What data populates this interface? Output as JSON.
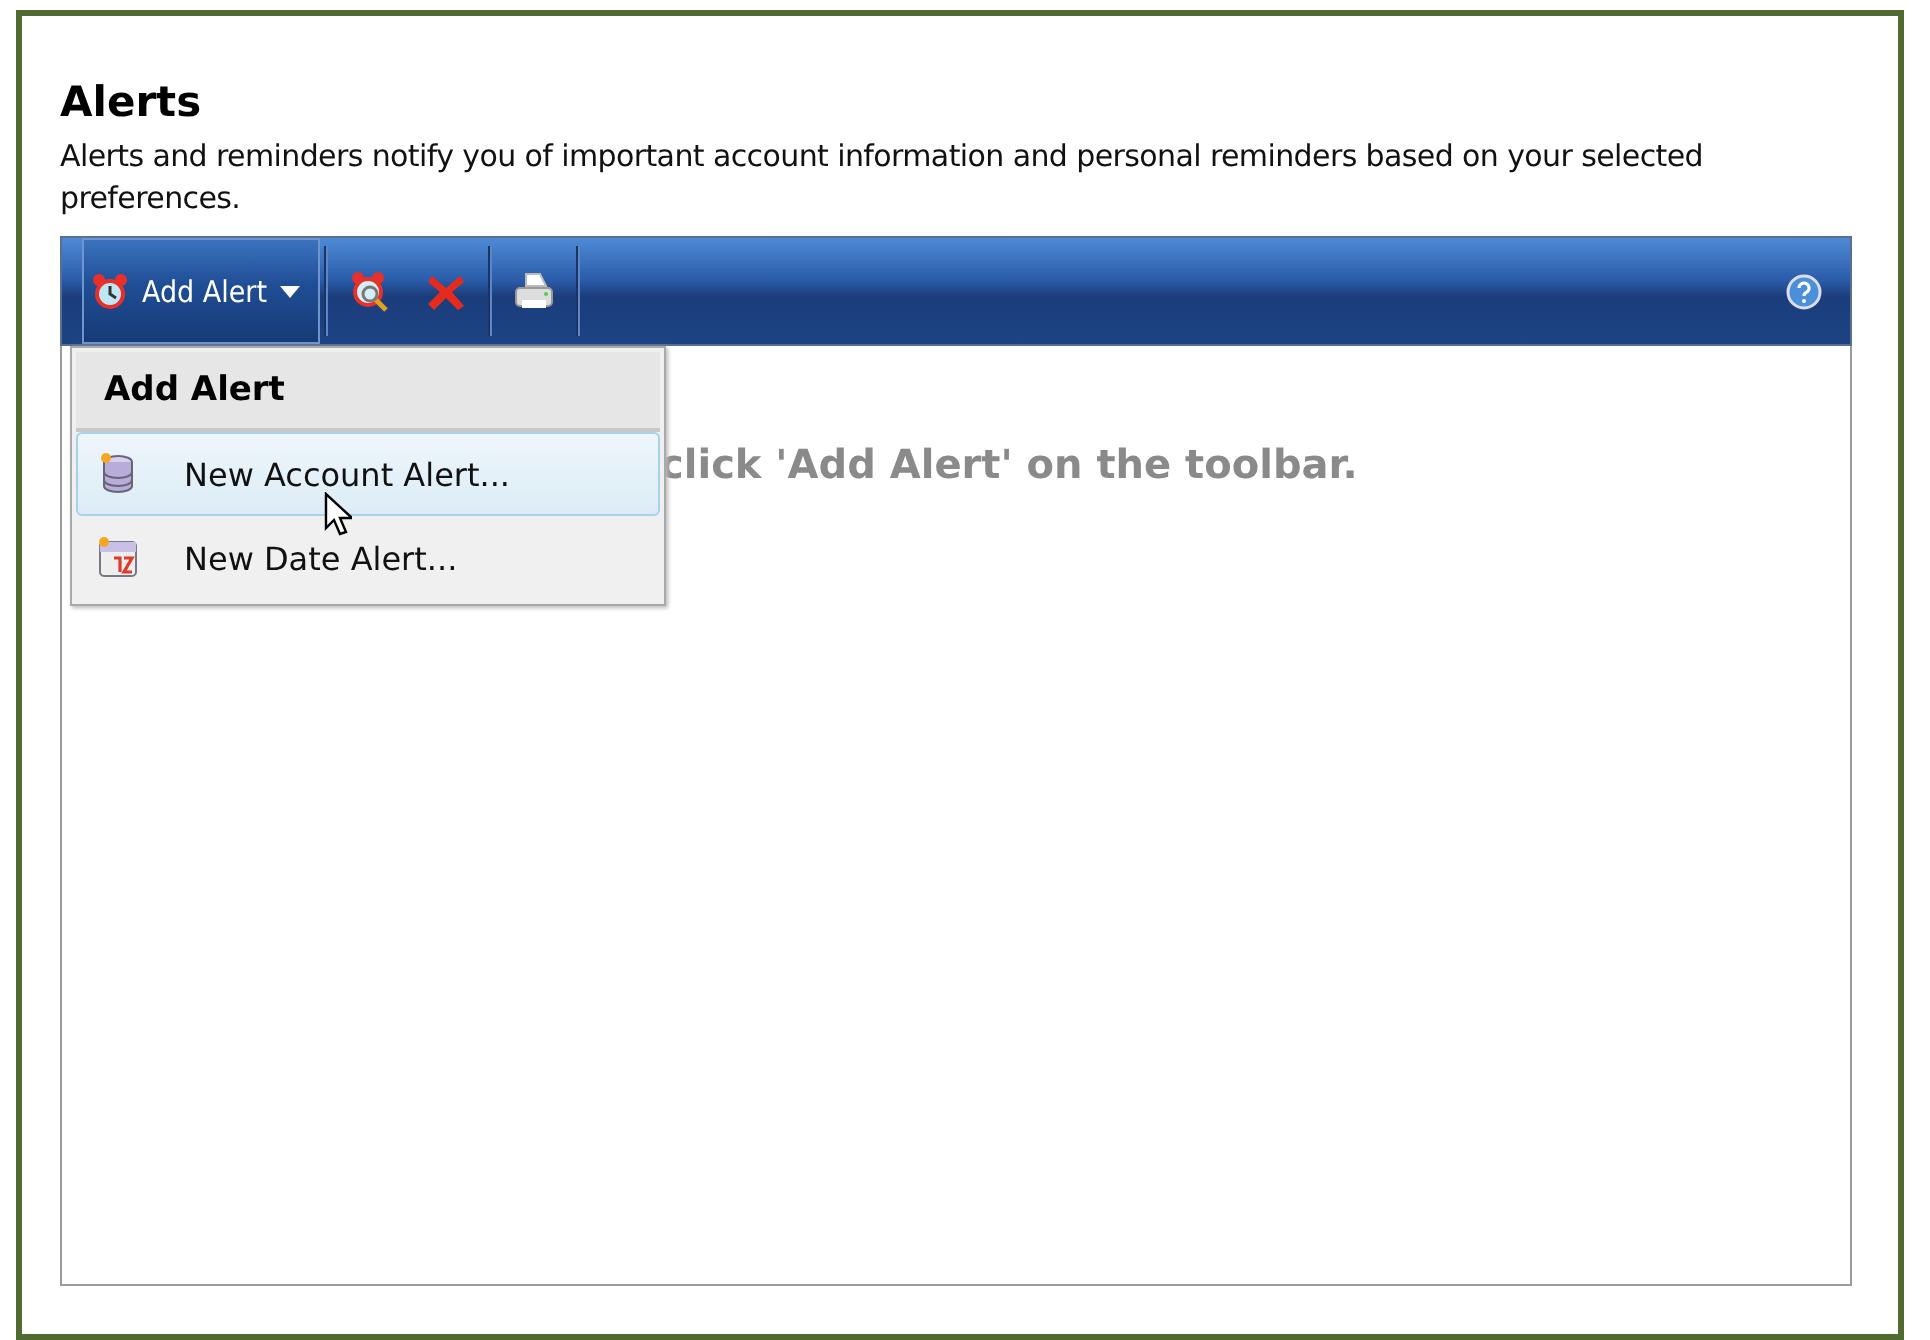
{
  "page": {
    "title": "Alerts",
    "description": "Alerts and reminders notify you of important account information and personal reminders based on your selected preferences."
  },
  "toolbar": {
    "add_button": {
      "label": "Add Alert",
      "expanded": true
    }
  },
  "menu": {
    "header": "Add Alert",
    "items": [
      {
        "kind": "account",
        "label": "New Account Alert...",
        "selected": true
      },
      {
        "kind": "date",
        "label": "New Date Alert...",
        "selected": false
      }
    ]
  },
  "message": "click 'Add Alert' on the toolbar."
}
